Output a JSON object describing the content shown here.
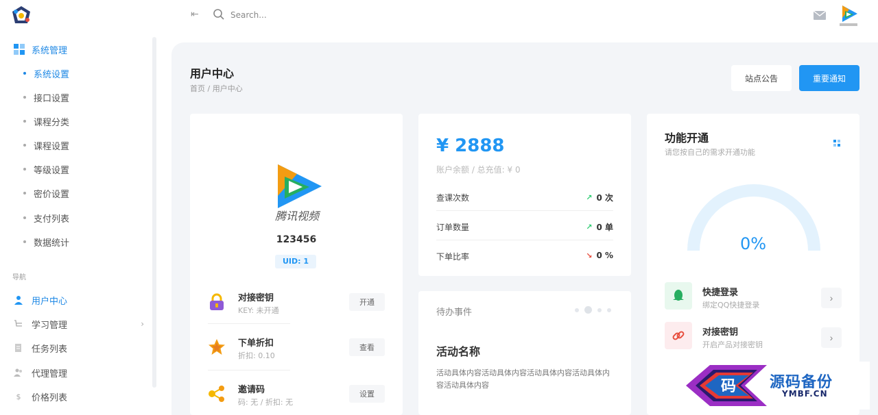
{
  "topbar": {
    "search_placeholder": "Search..."
  },
  "sidebar": {
    "group": {
      "label": "系统管理"
    },
    "sub_items": [
      {
        "label": "系统设置",
        "active": true
      },
      {
        "label": "接口设置"
      },
      {
        "label": "课程分类"
      },
      {
        "label": "课程设置"
      },
      {
        "label": "等级设置"
      },
      {
        "label": "密价设置"
      },
      {
        "label": "支付列表"
      },
      {
        "label": "数据统计"
      }
    ],
    "nav_label": "导航",
    "nav_items": [
      {
        "label": "用户中心",
        "active": true
      },
      {
        "label": "学习管理"
      },
      {
        "label": "任务列表"
      },
      {
        "label": "代理管理"
      },
      {
        "label": "价格列表"
      }
    ]
  },
  "page": {
    "title": "用户中心",
    "breadcrumb": "首页 / 用户中心",
    "btn_notice": "站点公告",
    "btn_important": "重要通知"
  },
  "profile": {
    "avatar_caption": "腾讯视频",
    "name": "123456",
    "uid": "UID: 1",
    "features": [
      {
        "title": "对接密钥",
        "sub": "KEY: 未开通",
        "btn": "开通",
        "icon": "lock-icon",
        "color": "#8e5ad6"
      },
      {
        "title": "下单折扣",
        "sub": "折扣: 0.10",
        "btn": "查看",
        "icon": "star-icon",
        "color": "#f39c12"
      },
      {
        "title": "邀请码",
        "sub": "码: 无 / 折扣: 无",
        "btn": "设置",
        "icon": "share-icon",
        "color": "#f5b800"
      }
    ]
  },
  "balance": {
    "amount": "¥ 2888",
    "sub": "账户余额 / 总充值: ¥ 0",
    "stats": [
      {
        "label": "查课次数",
        "value": "0 次",
        "trend": "up",
        "color": "#2ecc71"
      },
      {
        "label": "订单数量",
        "value": "0 单",
        "trend": "up",
        "color": "#2ecc71"
      },
      {
        "label": "下单比率",
        "value": "0 %",
        "trend": "down",
        "color": "#e74c3c"
      }
    ]
  },
  "todo": {
    "title": "待办事件",
    "activity_title": "活动名称",
    "activity_content": "活动具体内容活动具体内容活动具体内容活动具体内容活动具体内容"
  },
  "func": {
    "title": "功能开通",
    "sub": "请您按自己的需求开通功能",
    "gauge": {
      "percent": 0,
      "label": "0%"
    },
    "items": [
      {
        "title": "快捷登录",
        "sub": "绑定QQ快捷登录",
        "icon": "qq-icon",
        "bg": "#e8f8ee",
        "color": "#27ae60"
      },
      {
        "title": "对接密钥",
        "sub": "开启产品对接密钥",
        "icon": "link-icon",
        "bg": "#fdecee",
        "color": "#e74c3c"
      }
    ]
  },
  "watermark": {
    "text": "源码备份",
    "url": "YMBF.CN",
    "logo_char": "码"
  }
}
